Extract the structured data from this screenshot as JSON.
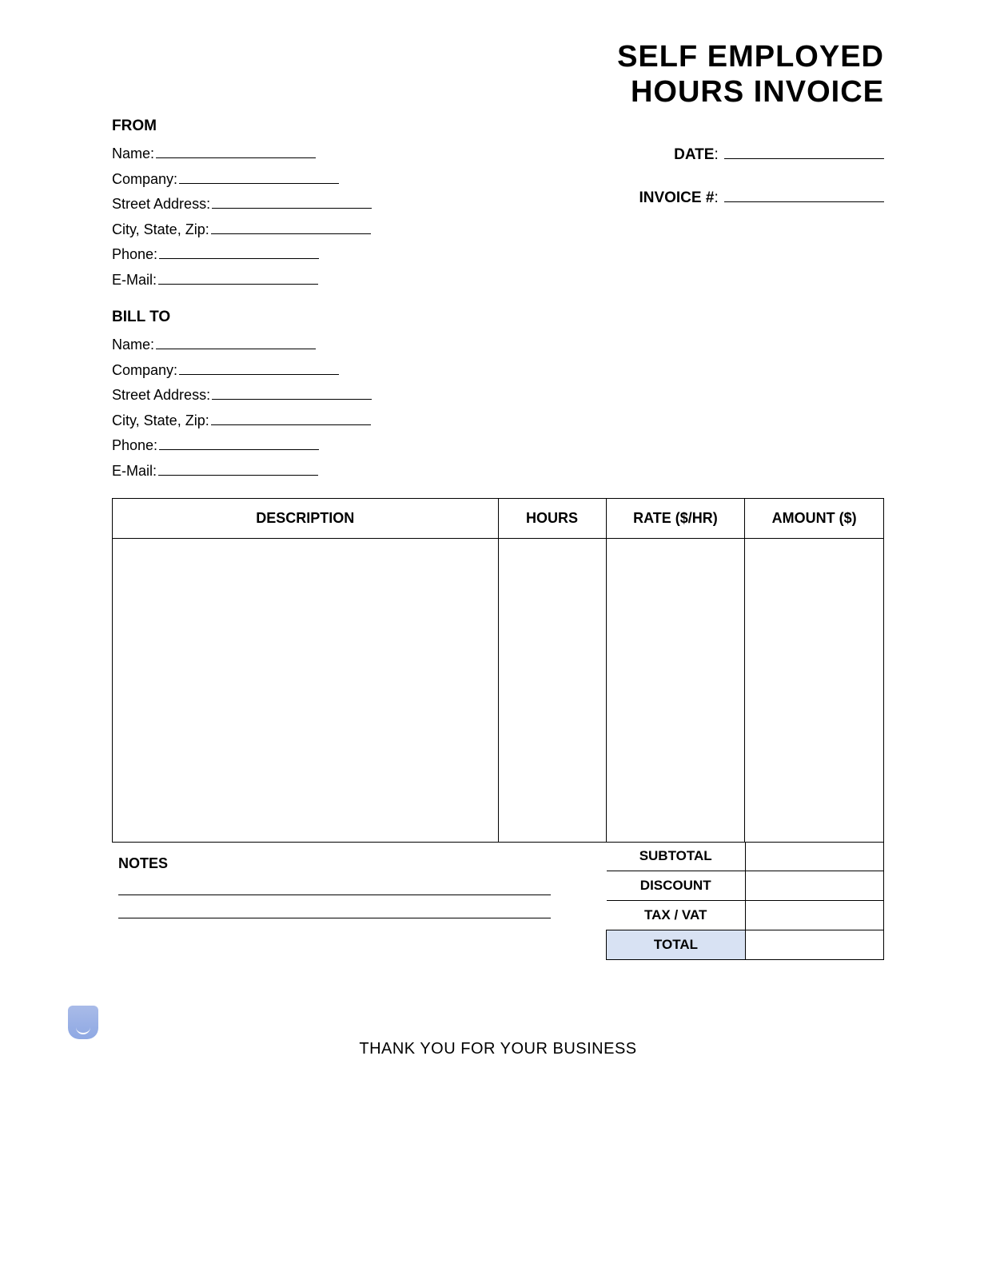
{
  "title_line1": "SELF EMPLOYED",
  "title_line2": "HOURS INVOICE",
  "sections": {
    "from_heading": "FROM",
    "billto_heading": "BILL TO",
    "notes_heading": "NOTES"
  },
  "labels": {
    "name": "Name:",
    "company": "Company:",
    "street": "Street Address:",
    "city": "City, State, Zip:",
    "phone": "Phone:",
    "email": "E-Mail:",
    "date": "DATE",
    "invoice_no": "INVOICE #",
    "colon": ":"
  },
  "from": {
    "name": "",
    "company": "",
    "street": "",
    "city": "",
    "phone": "",
    "email": ""
  },
  "bill_to": {
    "name": "",
    "company": "",
    "street": "",
    "city": "",
    "phone": "",
    "email": ""
  },
  "meta": {
    "date": "",
    "invoice_number": ""
  },
  "columns": {
    "description": "DESCRIPTION",
    "hours": "HOURS",
    "rate": "RATE ($/HR)",
    "amount": "AMOUNT ($)"
  },
  "totals": {
    "subtotal_label": "SUBTOTAL",
    "discount_label": "DISCOUNT",
    "tax_label": "TAX / VAT",
    "total_label": "TOTAL",
    "subtotal": "",
    "discount": "",
    "tax": "",
    "total": ""
  },
  "footer": "THANK YOU FOR YOUR BUSINESS"
}
